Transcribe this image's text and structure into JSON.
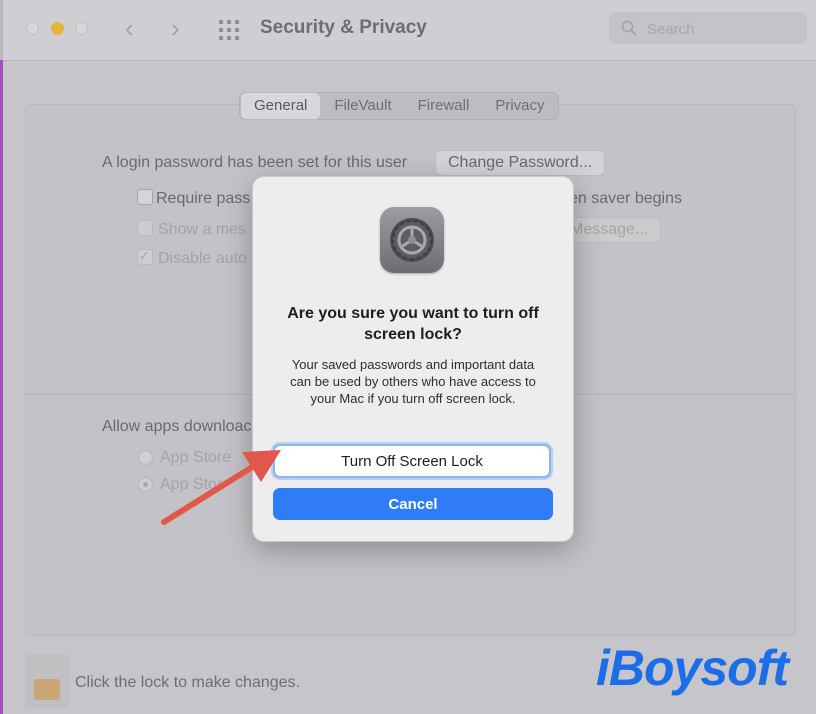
{
  "window": {
    "title": "Security & Privacy"
  },
  "toolbar": {
    "back_glyph": "‹",
    "forward_glyph": "›",
    "search_placeholder": "Search"
  },
  "tabs": [
    {
      "label": "General",
      "active": true
    },
    {
      "label": "FileVault",
      "active": false
    },
    {
      "label": "Firewall",
      "active": false
    },
    {
      "label": "Privacy",
      "active": false
    }
  ],
  "general": {
    "login_text": "A login password has been set for this user",
    "change_password_label": "Change Password...",
    "require_left": "Require pass",
    "require_right": "en saver begins",
    "show_message_left": "Show a mes",
    "set_message_right": "Message...",
    "disable_auto_left": "Disable auto",
    "allow_apps_text": "Allow apps downloac",
    "app_store_label": "App Store",
    "app_store_devs_label": "App Stor"
  },
  "footer": {
    "lock_text": "Click the lock to make changes."
  },
  "dialog": {
    "title": "Are you sure you want to turn off screen lock?",
    "message": "Your saved passwords and important data can be used by others who have access to your Mac if you turn off screen lock.",
    "turn_off_label": "Turn Off Screen Lock",
    "cancel_label": "Cancel"
  },
  "icons": {
    "app": "system-preferences-gear-icon",
    "lock": "padlock-icon",
    "search": "magnifier-icon",
    "grid": "app-grid-icon"
  },
  "colors": {
    "accent": "#2f7cf6",
    "annotation_arrow": "#e2574c",
    "watermark": "#1c6ee8",
    "minimize_light": "#e7b53a"
  },
  "watermark": {
    "text": "iBoysoft"
  }
}
